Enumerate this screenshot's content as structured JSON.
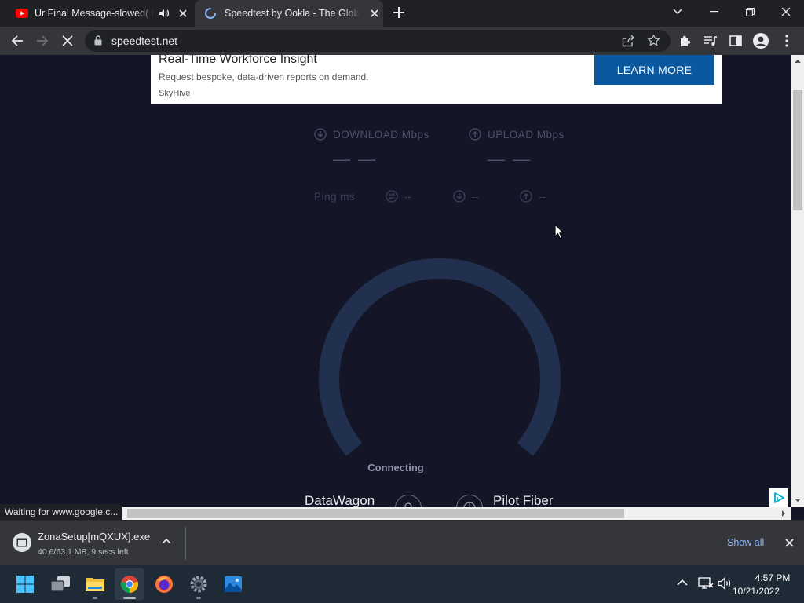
{
  "browser": {
    "tabs": [
      {
        "title": "Ur Final Message-slowed( ba",
        "favicon": "youtube-icon",
        "audio": "speaker-icon"
      },
      {
        "title": "Speedtest by Ookla - The Global",
        "favicon": "loading-spinner-icon"
      }
    ],
    "url": "speedtest.net"
  },
  "ad": {
    "title": "Real-Time Workforce Insight",
    "description": "Request bespoke, data-driven reports on demand.",
    "brand": "SkyHive",
    "cta": "LEARN MORE"
  },
  "speedtest": {
    "download_label": "DOWNLOAD Mbps",
    "upload_label": "UPLOAD Mbps",
    "download_value": "— —",
    "upload_value": "— —",
    "ping_label": "Ping ms",
    "ping_idle": "--",
    "ping_download": "--",
    "ping_upload": "--",
    "status": "Connecting",
    "host_isp": "DataWagon",
    "server_isp": "Pilot Fiber"
  },
  "status_bar": "Waiting for www.google.c...",
  "download": {
    "filename": "ZonaSetup[mQXUX].exe",
    "progress": "40.6/63.1 MB, 9 secs left",
    "show_all": "Show all"
  },
  "taskbar": {
    "time": "4:57 PM",
    "date": "10/21/2022"
  },
  "colors": {
    "page_bg": "#141526",
    "gauge": "#22304f",
    "ad_button": "#0a58a0"
  }
}
